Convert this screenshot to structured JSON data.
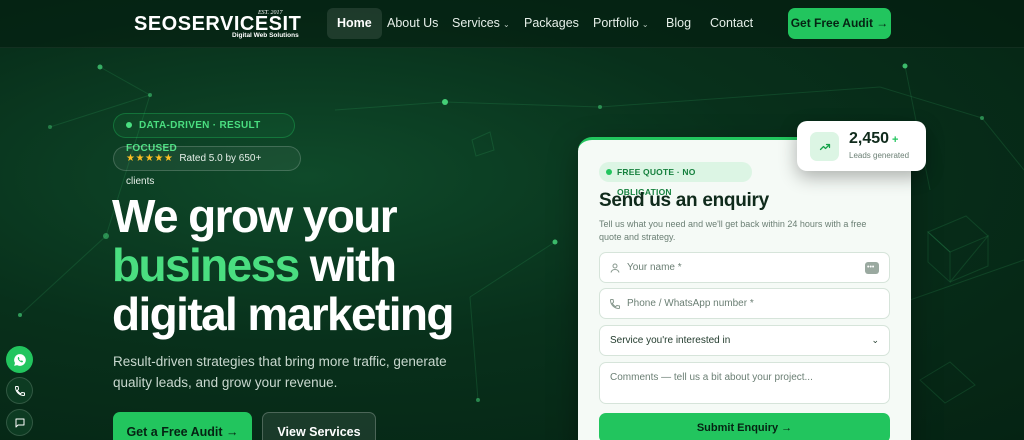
{
  "brand": {
    "name": "SEOSERVICESIT",
    "est": "EST. 2017",
    "tagline": "Digital Web Solutions"
  },
  "nav": {
    "items": [
      {
        "label": "Home",
        "active": true
      },
      {
        "label": "About Us"
      },
      {
        "label": "Services",
        "dropdown": true
      },
      {
        "label": "Packages"
      },
      {
        "label": "Portfolio",
        "dropdown": true
      },
      {
        "label": "Blog"
      },
      {
        "label": "Contact"
      }
    ],
    "cta": "Get Free Audit →"
  },
  "hero": {
    "badge": "DATA-DRIVEN · RESULT FOCUSED",
    "rating_stars": "★★★★★",
    "rating_text": "Rated 5.0 by 650+ clients",
    "headline_line1": "We grow your",
    "headline_accent": "business",
    "headline_line2_rest": " with",
    "headline_line3": "digital marketing",
    "subtext": "Result-driven strategies that bring more traffic, generate quality leads, and grow your revenue.",
    "primary_button": "Get a Free Audit",
    "primary_button_arrow": "→",
    "secondary_button": "View Services"
  },
  "stat": {
    "value": "2,450",
    "plus": "+",
    "label": "Leads generated"
  },
  "form": {
    "tag": "FREE QUOTE · NO OBLIGATION",
    "title": "Send us an enquiry",
    "description": "Tell us what you need and we'll get back within 24 hours with a free quote and strategy.",
    "name_placeholder": "Your name *",
    "phone_placeholder": "Phone / WhatsApp number *",
    "service_selected": "Service you're interested in",
    "comments_placeholder": "Comments — tell us a bit about your project...",
    "submit": "Submit Enquiry →"
  },
  "colors": {
    "accent": "#22c55e",
    "accent_light": "#4ade80",
    "bg_dark": "#052313"
  },
  "icons": [
    "whatsapp-icon",
    "phone-icon",
    "chat-icon",
    "trend-up-icon",
    "user-icon"
  ]
}
